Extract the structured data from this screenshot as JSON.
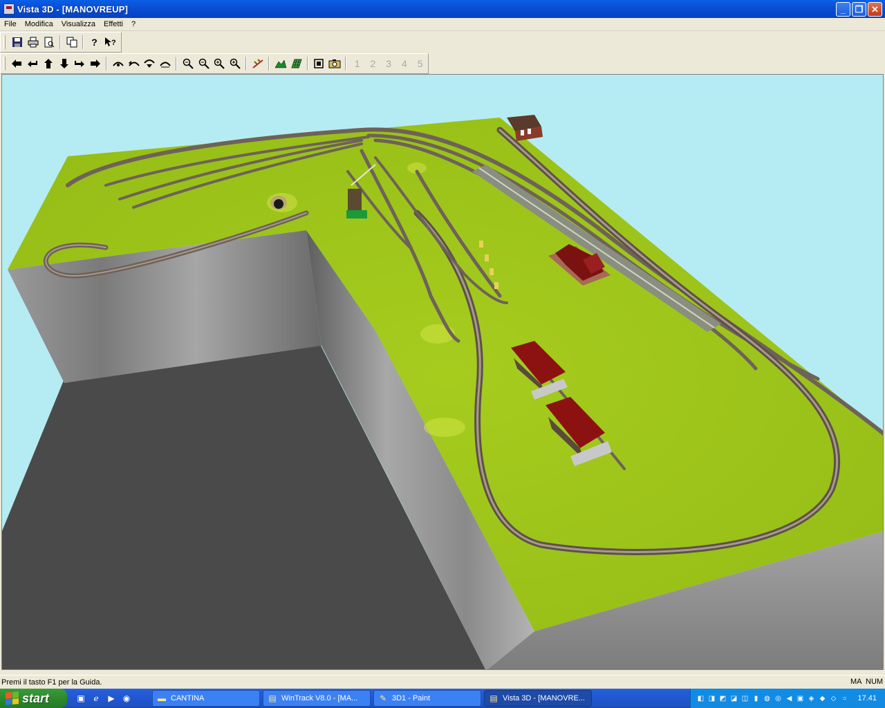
{
  "window": {
    "title": "Vista 3D - [MANOVREUP]",
    "buttons": {
      "minimize": "_",
      "restore": "❐",
      "close": "✕"
    }
  },
  "menu": [
    "File",
    "Modifica",
    "Visualizza",
    "Effetti",
    "?"
  ],
  "toolbar1": [
    {
      "name": "save-icon",
      "glyph": "💾"
    },
    {
      "name": "print-icon",
      "glyph": "🖶"
    },
    {
      "name": "print-preview-icon",
      "glyph": "🔍"
    },
    {
      "name": "copy-icon",
      "glyph": "⎘"
    },
    {
      "name": "help-icon",
      "glyph": "?"
    },
    {
      "name": "context-help-icon",
      "glyph": "?"
    }
  ],
  "toolbar2": {
    "move_icons": [
      "arrow-left-icon",
      "rotate-left-icon",
      "arrow-up-icon",
      "arrow-down-icon",
      "rotate-right-icon",
      "arrow-right-icon"
    ],
    "camera_icons": [
      "view-a-icon",
      "view-b-icon",
      "view-c-icon",
      "view-d-icon"
    ],
    "zoom_icons": [
      "zoom-out-all-icon",
      "zoom-out-icon",
      "zoom-in-icon",
      "zoom-in-all-icon"
    ],
    "disabled_labels": [
      "1",
      "2",
      "3",
      "4",
      "5"
    ]
  },
  "status": {
    "message": "Premi il tasto F1 per la Guida.",
    "indicators": [
      "MA",
      "NUM"
    ]
  },
  "taskbar": {
    "start_label": "start",
    "tasks": [
      {
        "label": "CANTINA",
        "icon": "folder-icon"
      },
      {
        "label": "WinTrack V8.0 - [MA...",
        "icon": "wintrack-icon"
      },
      {
        "label": "3D1 - Paint",
        "icon": "paint-icon"
      },
      {
        "label": "Vista 3D - [MANOVRE...",
        "icon": "wintrack-icon"
      }
    ],
    "clock": "17.41"
  },
  "colors": {
    "sky": "#b5ecf3",
    "terrain": "#9ec71c",
    "cliff": "#8a8a8a",
    "shadow": "#4a4a4a",
    "roof": "#8c1212"
  }
}
